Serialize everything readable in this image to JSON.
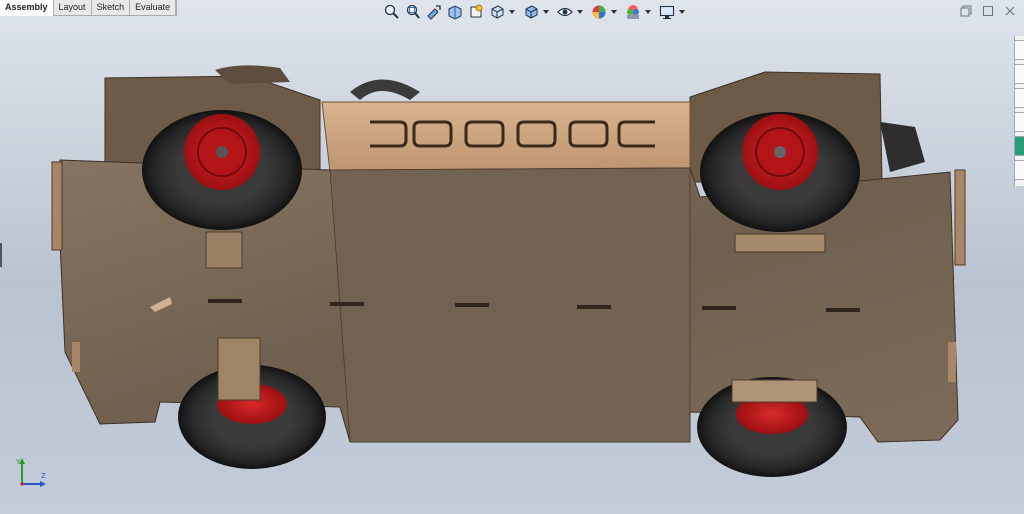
{
  "tabs": [
    {
      "label": "Assembly",
      "active": true
    },
    {
      "label": "Layout",
      "active": false
    },
    {
      "label": "Sketch",
      "active": false
    },
    {
      "label": "Evaluate",
      "active": false
    }
  ],
  "heads_up_toolbar": [
    "zoom-to-fit-icon",
    "zoom-to-area-icon",
    "previous-view-icon",
    "section-view-icon",
    "dynamic-annotation-icon",
    "view-orientation-icon",
    "display-style-icon",
    "hide-show-items-icon",
    "edit-appearance-icon",
    "apply-scene-icon",
    "view-settings-icon"
  ],
  "window_controls": [
    "restore-down-icon",
    "maximize-icon",
    "close-icon"
  ],
  "triad": {
    "y": "Y",
    "z": "Z"
  },
  "colors": {
    "plywood": "#7a6a5a",
    "plywood_light": "#c9a27e",
    "tire": "#2b2b2b",
    "rim": "#c8171b",
    "background_top": "#dfe4ec",
    "background_bottom": "#b9c3d0"
  }
}
